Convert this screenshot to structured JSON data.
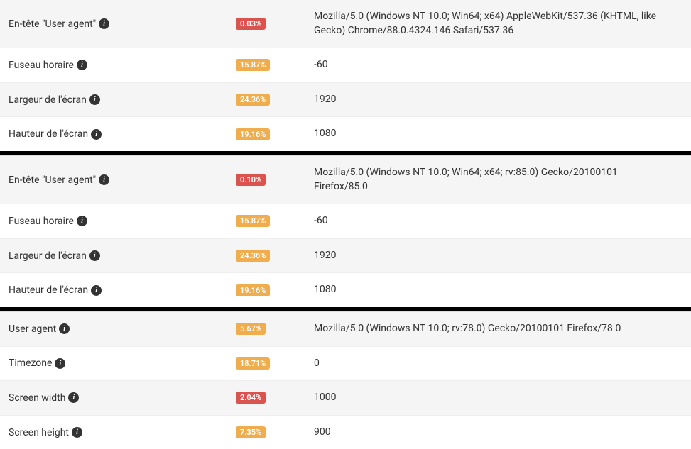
{
  "sections": [
    {
      "rows": [
        {
          "label": "En-tête \"User agent\"",
          "badge": "0.03%",
          "badgeColor": "red",
          "value": "Mozilla/5.0 (Windows NT 10.0; Win64; x64) AppleWebKit/537.36 (KHTML, like Gecko) Chrome/88.0.4324.146 Safari/537.36",
          "alt": true
        },
        {
          "label": "Fuseau horaire",
          "badge": "15.87%",
          "badgeColor": "orange",
          "value": "-60",
          "alt": false
        },
        {
          "label": "Largeur de l'écran",
          "badge": "24.36%",
          "badgeColor": "orange",
          "value": "1920",
          "alt": true
        },
        {
          "label": "Hauteur de l'écran",
          "badge": "19.16%",
          "badgeColor": "orange",
          "value": "1080",
          "alt": false
        }
      ]
    },
    {
      "rows": [
        {
          "label": "En-tête \"User agent\"",
          "badge": "0.10%",
          "badgeColor": "red",
          "value": "Mozilla/5.0 (Windows NT 10.0; Win64; x64; rv:85.0) Gecko/20100101 Firefox/85.0",
          "alt": true
        },
        {
          "label": "Fuseau horaire",
          "badge": "15.87%",
          "badgeColor": "orange",
          "value": "-60",
          "alt": false
        },
        {
          "label": "Largeur de l'écran",
          "badge": "24.36%",
          "badgeColor": "orange",
          "value": "1920",
          "alt": true
        },
        {
          "label": "Hauteur de l'écran",
          "badge": "19.16%",
          "badgeColor": "orange",
          "value": "1080",
          "alt": false
        }
      ]
    },
    {
      "rows": [
        {
          "label": "User agent",
          "badge": "5.67%",
          "badgeColor": "orange",
          "value": "Mozilla/5.0 (Windows NT 10.0; rv:78.0) Gecko/20100101 Firefox/78.0",
          "alt": true
        },
        {
          "label": "Timezone",
          "badge": "18.71%",
          "badgeColor": "orange",
          "value": "0",
          "alt": false
        },
        {
          "label": "Screen width",
          "badge": "2.04%",
          "badgeColor": "red",
          "value": "1000",
          "alt": true
        },
        {
          "label": "Screen height",
          "badge": "7.35%",
          "badgeColor": "orange",
          "value": "900",
          "alt": false
        }
      ]
    }
  ]
}
